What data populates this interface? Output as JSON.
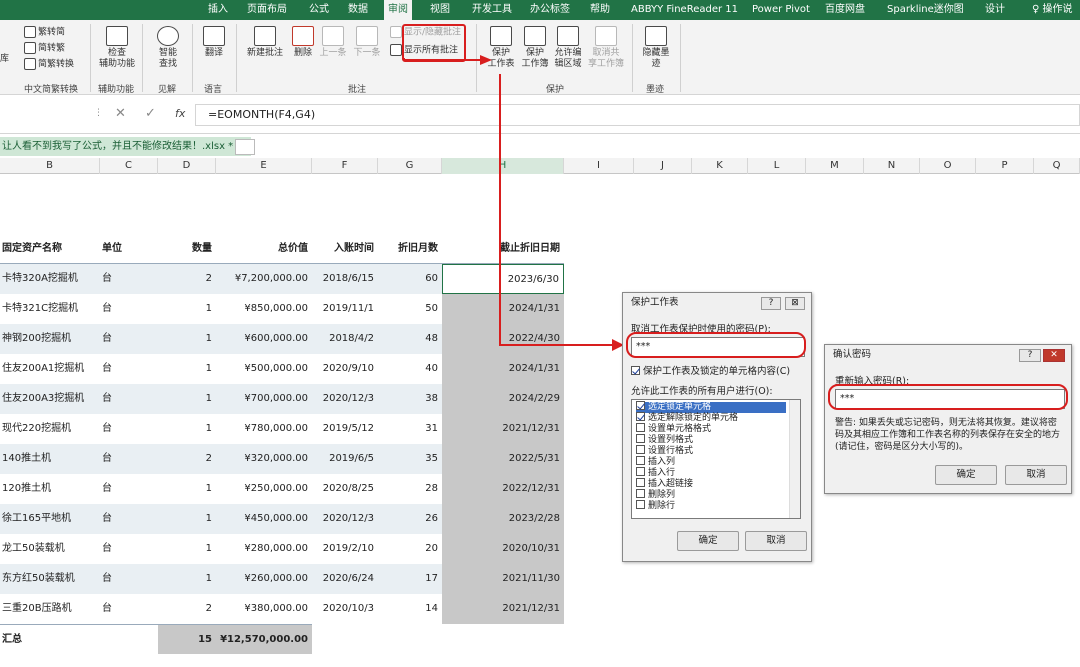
{
  "tabs": [
    "插入",
    "页面布局",
    "公式",
    "数据",
    "审阅",
    "视图",
    "开发工具",
    "办公标签",
    "帮助",
    "ABBYY FineReader 11",
    "Power Pivot",
    "百度网盘",
    "Sparkline迷你图",
    "设计",
    "操作说"
  ],
  "ribbon": {
    "chinese": {
      "b1": "繁转简",
      "b2": "简转繁",
      "b3": "简繁转换",
      "label": "中文简繁转换"
    },
    "lib": "库",
    "access": {
      "b1": "检查",
      "b2": "辅助功能",
      "label": "辅助功能"
    },
    "insights": {
      "b1": "智能",
      "b2": "查找",
      "label": "见解"
    },
    "language": {
      "b1": "翻译",
      "label": "语言"
    },
    "comments": {
      "new": "新建批注",
      "delete": "删除",
      "prev": "上一条",
      "next": "下一条",
      "showhide": "显示/隐藏批注",
      "showall": "显示所有批注",
      "label": "批注"
    },
    "protect": {
      "sheet1": "保护",
      "sheet2": "工作表",
      "book1": "保护",
      "book2": "工作簿",
      "range1": "允许编",
      "range2": "辑区域",
      "share1": "取消共",
      "share2": "享工作簿",
      "label": "保护"
    },
    "ink": {
      "b1": "隐藏墨",
      "b2": "迹",
      "label": "墨迹"
    }
  },
  "formula": {
    "fx": "fx",
    "value": "=EOMONTH(F4,G4)"
  },
  "file_tab": "让人看不到我写了公式，并且不能修改结果！.xlsx *",
  "columns": [
    "B",
    "C",
    "D",
    "E",
    "F",
    "G",
    "H",
    "I",
    "J",
    "K",
    "L",
    "M",
    "N",
    "O",
    "P",
    "Q"
  ],
  "table": {
    "headers": [
      "固定资产名称",
      "单位",
      "数量",
      "总价值",
      "入账时间",
      "折旧月数",
      "截止折旧日期"
    ],
    "rows": [
      [
        "卡特320A挖掘机",
        "台",
        "2",
        "¥7,200,000.00",
        "2018/6/15",
        "60",
        "2023/6/30"
      ],
      [
        "卡特321C挖掘机",
        "台",
        "1",
        "¥850,000.00",
        "2019/11/1",
        "50",
        "2024/1/31"
      ],
      [
        "神钢200挖掘机",
        "台",
        "1",
        "¥600,000.00",
        "2018/4/2",
        "48",
        "2022/4/30"
      ],
      [
        "住友200A1挖掘机",
        "台",
        "1",
        "¥500,000.00",
        "2020/9/10",
        "40",
        "2024/1/31"
      ],
      [
        "住友200A3挖掘机",
        "台",
        "1",
        "¥700,000.00",
        "2020/12/3",
        "38",
        "2024/2/29"
      ],
      [
        "现代220挖掘机",
        "台",
        "1",
        "¥780,000.00",
        "2019/5/12",
        "31",
        "2021/12/31"
      ],
      [
        "140推土机",
        "台",
        "2",
        "¥320,000.00",
        "2019/6/5",
        "35",
        "2022/5/31"
      ],
      [
        "120推土机",
        "台",
        "1",
        "¥250,000.00",
        "2020/8/25",
        "28",
        "2022/12/31"
      ],
      [
        "徐工165平地机",
        "台",
        "1",
        "¥450,000.00",
        "2020/12/3",
        "26",
        "2023/2/28"
      ],
      [
        "龙工50装载机",
        "台",
        "1",
        "¥280,000.00",
        "2019/2/10",
        "20",
        "2020/10/31"
      ],
      [
        "东方红50装载机",
        "台",
        "1",
        "¥260,000.00",
        "2020/6/24",
        "17",
        "2021/11/30"
      ],
      [
        "三重20B压路机",
        "台",
        "2",
        "¥380,000.00",
        "2020/10/3",
        "14",
        "2021/12/31"
      ]
    ],
    "total": {
      "label": "汇总",
      "qty": "15",
      "value": "¥12,570,000.00"
    }
  },
  "protect_dialog": {
    "title": "保护工作表",
    "pwd_label": "取消工作表保护时使用的密码(P):",
    "pwd_value": "***",
    "protect_chk": "保护工作表及锁定的单元格内容(C)",
    "allow_label": "允许此工作表的所有用户进行(O):",
    "options": [
      {
        "label": "选定锁定单元格",
        "on": true
      },
      {
        "label": "选定解除锁定的单元格",
        "on": true
      },
      {
        "label": "设置单元格格式",
        "on": false
      },
      {
        "label": "设置列格式",
        "on": false
      },
      {
        "label": "设置行格式",
        "on": false
      },
      {
        "label": "插入列",
        "on": false
      },
      {
        "label": "插入行",
        "on": false
      },
      {
        "label": "插入超链接",
        "on": false
      },
      {
        "label": "删除列",
        "on": false
      },
      {
        "label": "删除行",
        "on": false
      }
    ],
    "ok": "确定",
    "cancel": "取消"
  },
  "confirm_dialog": {
    "title": "确认密码",
    "label": "重新输入密码(R):",
    "value": "***",
    "warning": "警告: 如果丢失或忘记密码，则无法将其恢复。建议将密码及其相应工作簿和工作表名称的列表保存在安全的地方(请记住，密码是区分大小写的)。",
    "ok": "确定",
    "cancel": "取消"
  },
  "colors": {
    "excel_green": "#217346",
    "highlight_red": "#d81e1e",
    "selected_col": "#c8c8c8",
    "row_alt": "#e9eff3"
  }
}
